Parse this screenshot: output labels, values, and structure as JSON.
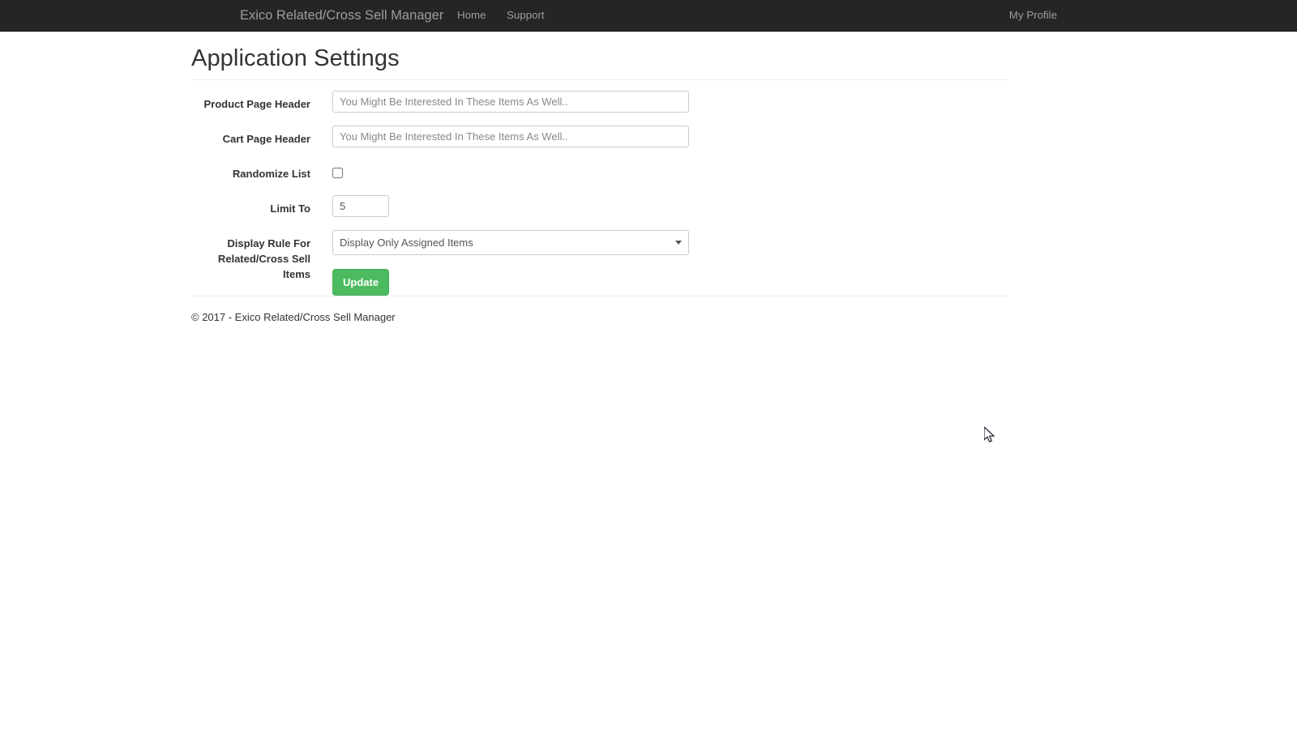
{
  "navbar": {
    "brand": "Exico Related/Cross Sell Manager",
    "links": [
      {
        "label": "Home",
        "name": "nav-link-home"
      },
      {
        "label": "Support",
        "name": "nav-link-support"
      }
    ],
    "profile_label": "My Profile",
    "background_color": "#252525",
    "link_color": "#9d9d9d"
  },
  "page": {
    "title": "Application Settings"
  },
  "form": {
    "product_page_header": {
      "label": "Product Page Header",
      "value": "",
      "placeholder": "You Might Be Interested In These Items As Well.."
    },
    "cart_page_header": {
      "label": "Cart Page Header",
      "value": "",
      "placeholder": "You Might Be Interested In These Items As Well.."
    },
    "randomize_list": {
      "label": "Randomize List",
      "checked": false
    },
    "limit_to": {
      "label": "Limit To",
      "value": "5"
    },
    "display_rule": {
      "label": "Display Rule For Related/Cross Sell Items",
      "label_line_1": "Display Rule For",
      "label_line_2": "Related/Cross Sell Items",
      "selected": "Display Only Assigned Items"
    },
    "update_button": {
      "label": "Update",
      "color": "#4cbb60"
    }
  },
  "footer": {
    "text": "© 2017 - Exico Related/Cross Sell Manager"
  }
}
